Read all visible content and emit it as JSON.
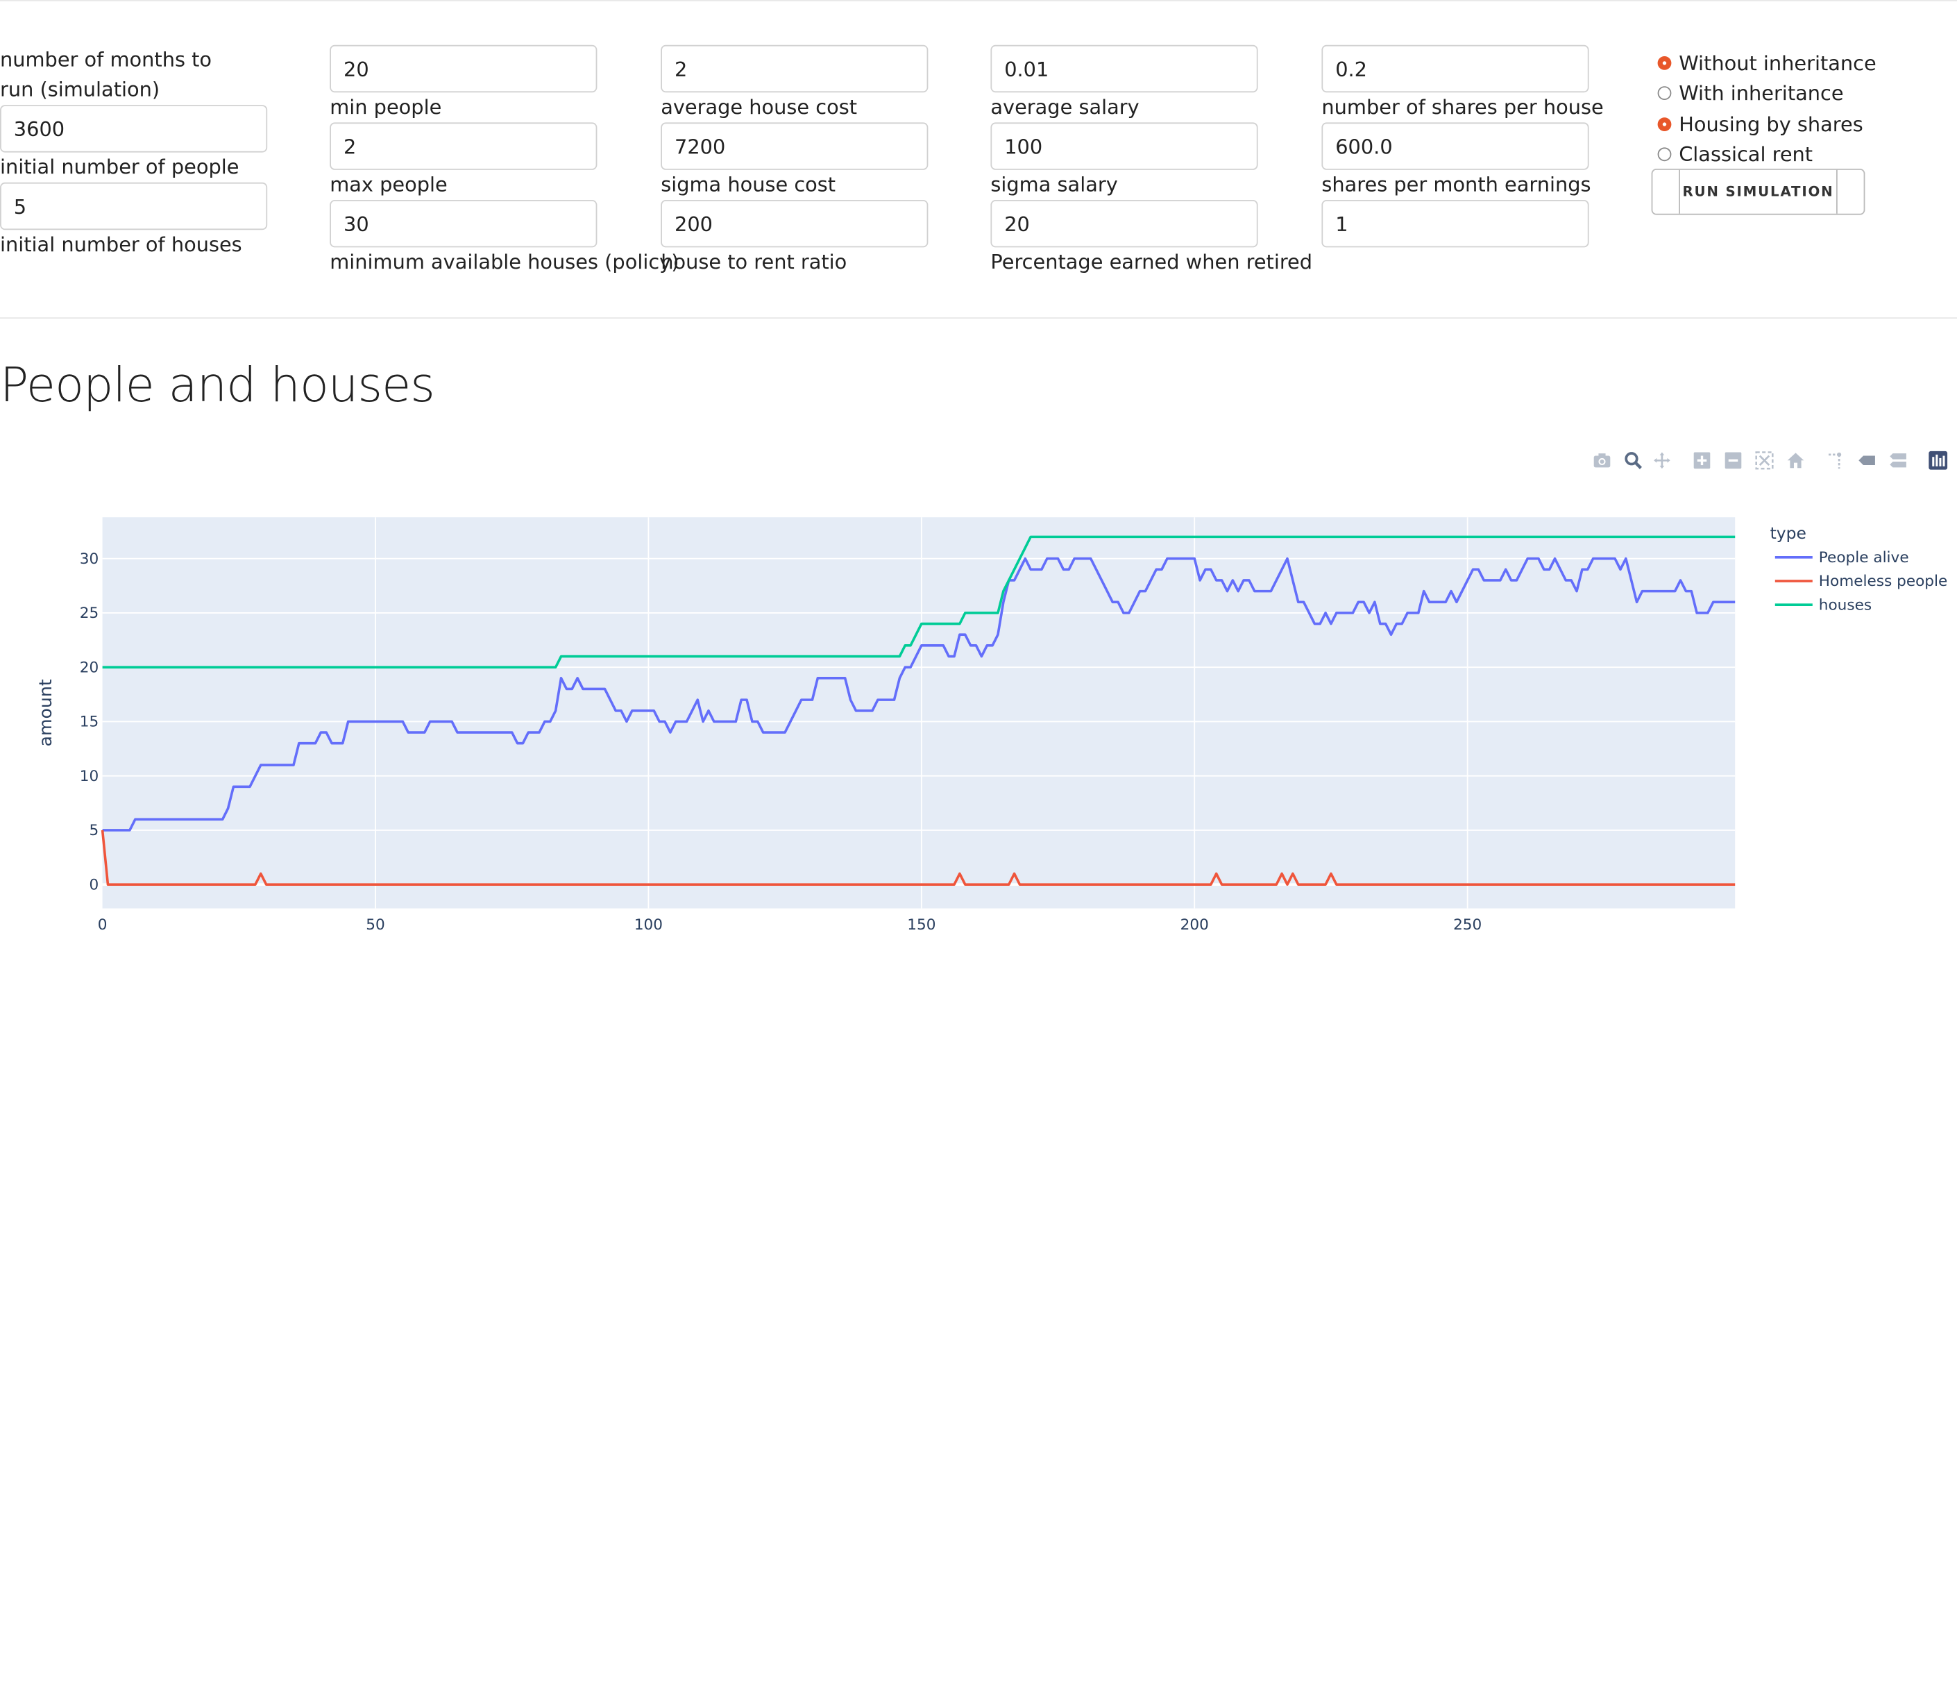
{
  "form": {
    "col1": {
      "label_months": "number of months to run (simulation)",
      "value_months": "3600",
      "label_people": "initial number of people",
      "value_people": "5",
      "label_houses": "initial number of houses"
    },
    "col2": {
      "value_initial_houses": "20",
      "label_min_people": "min people",
      "value_min_people": "2",
      "label_max_people": "max people",
      "value_max_people": "30",
      "label_min_available": "minimum available houses (policy)"
    },
    "col3": {
      "value_min_available": "2",
      "label_avg_house_cost": "average house cost",
      "value_avg_house_cost": "7200",
      "label_sigma_house_cost": "sigma house cost",
      "value_sigma_house_cost": "200",
      "label_house_rent_ratio": "house to rent ratio"
    },
    "col4": {
      "value_house_rent_ratio": "0.01",
      "label_avg_salary": "average salary",
      "value_avg_salary": "100",
      "label_sigma_salary": "sigma salary",
      "value_sigma_salary": "20",
      "label_pct_retired": "Percentage earned when retired"
    },
    "col5": {
      "value_pct_retired": "0.2",
      "label_shares_per_house": "number of shares per house",
      "value_shares_per_house": "600.0",
      "label_shares_earnings": "shares per month earnings",
      "value_shares_earnings": "1"
    },
    "radios": {
      "without_inheritance": "Without inheritance",
      "with_inheritance": "With inheritance",
      "housing_by_shares": "Housing by shares",
      "classical_rent": "Classical rent",
      "selected": [
        "Without inheritance",
        "Housing by shares"
      ]
    },
    "run_button": "RUN SIMULATION"
  },
  "section_title": "People and houses",
  "modebar_icons": [
    "camera-icon",
    "zoom-icon",
    "pan-icon",
    "zoom-in-icon",
    "zoom-out-icon",
    "autoscale-icon",
    "reset-axes-icon",
    "spike-lines-icon",
    "hover-closest-icon",
    "hover-compare-icon",
    "plotly-logo-icon"
  ],
  "colors": {
    "accent_radio": "#e8572a",
    "plot_bg": "#e5ecf6",
    "people": "#636efa",
    "homeless": "#ef553b",
    "houses": "#00cc96"
  },
  "chart_data": {
    "type": "line",
    "xlabel": "",
    "ylabel": "amount",
    "legend_title": "type",
    "legend_position": "right",
    "grid": true,
    "xlim": [
      0,
      299
    ],
    "ylim": [
      -2.2,
      33.8
    ],
    "xticks": [
      0,
      50,
      100,
      150,
      200,
      250
    ],
    "yticks": [
      0,
      5,
      10,
      15,
      20,
      25,
      30
    ],
    "series": [
      {
        "name": "People alive",
        "color": "#636efa",
        "points": [
          [
            0,
            5
          ],
          [
            5,
            5
          ],
          [
            6,
            6
          ],
          [
            22,
            6
          ],
          [
            23,
            7
          ],
          [
            24,
            9
          ],
          [
            27,
            9
          ],
          [
            29,
            11
          ],
          [
            35,
            11
          ],
          [
            36,
            13
          ],
          [
            39,
            13
          ],
          [
            40,
            14
          ],
          [
            41,
            14
          ],
          [
            42,
            13
          ],
          [
            44,
            13
          ],
          [
            45,
            15
          ],
          [
            55,
            15
          ],
          [
            56,
            14
          ],
          [
            59,
            14
          ],
          [
            60,
            15
          ],
          [
            64,
            15
          ],
          [
            65,
            14
          ],
          [
            75,
            14
          ],
          [
            76,
            13
          ],
          [
            77,
            13
          ],
          [
            78,
            14
          ],
          [
            80,
            14
          ],
          [
            81,
            15
          ],
          [
            82,
            15
          ],
          [
            83,
            16
          ],
          [
            84,
            19
          ],
          [
            85,
            18
          ],
          [
            86,
            18
          ],
          [
            87,
            19
          ],
          [
            88,
            18
          ],
          [
            92,
            18
          ],
          [
            94,
            16
          ],
          [
            95,
            16
          ],
          [
            96,
            15
          ],
          [
            97,
            16
          ],
          [
            101,
            16
          ],
          [
            102,
            15
          ],
          [
            103,
            15
          ],
          [
            104,
            14
          ],
          [
            105,
            15
          ],
          [
            107,
            15
          ],
          [
            108,
            16
          ],
          [
            109,
            17
          ],
          [
            110,
            15
          ],
          [
            111,
            16
          ],
          [
            112,
            15
          ],
          [
            116,
            15
          ],
          [
            117,
            17
          ],
          [
            118,
            17
          ],
          [
            119,
            15
          ],
          [
            120,
            15
          ],
          [
            121,
            14
          ],
          [
            125,
            14
          ],
          [
            127,
            16
          ],
          [
            128,
            17
          ],
          [
            130,
            17
          ],
          [
            131,
            19
          ],
          [
            136,
            19
          ],
          [
            137,
            17
          ],
          [
            138,
            16
          ],
          [
            141,
            16
          ],
          [
            142,
            17
          ],
          [
            145,
            17
          ],
          [
            146,
            19
          ],
          [
            147,
            20
          ],
          [
            148,
            20
          ],
          [
            149,
            21
          ],
          [
            150,
            22
          ],
          [
            154,
            22
          ],
          [
            155,
            21
          ],
          [
            156,
            21
          ],
          [
            157,
            23
          ],
          [
            158,
            23
          ],
          [
            159,
            22
          ],
          [
            160,
            22
          ],
          [
            161,
            21
          ],
          [
            162,
            22
          ],
          [
            163,
            22
          ],
          [
            164,
            23
          ],
          [
            165,
            26
          ],
          [
            166,
            28
          ],
          [
            167,
            28
          ],
          [
            168,
            29
          ],
          [
            169,
            30
          ],
          [
            170,
            29
          ],
          [
            172,
            29
          ],
          [
            173,
            30
          ],
          [
            175,
            30
          ],
          [
            176,
            29
          ],
          [
            177,
            29
          ],
          [
            178,
            30
          ],
          [
            181,
            30
          ],
          [
            182,
            29
          ],
          [
            184,
            27
          ],
          [
            185,
            26
          ],
          [
            186,
            26
          ],
          [
            187,
            25
          ],
          [
            188,
            25
          ],
          [
            189,
            26
          ],
          [
            190,
            27
          ],
          [
            191,
            27
          ],
          [
            192,
            28
          ],
          [
            193,
            29
          ],
          [
            194,
            29
          ],
          [
            195,
            30
          ],
          [
            200,
            30
          ],
          [
            201,
            28
          ],
          [
            202,
            29
          ],
          [
            203,
            29
          ],
          [
            204,
            28
          ],
          [
            205,
            28
          ],
          [
            206,
            27
          ],
          [
            207,
            28
          ],
          [
            208,
            27
          ],
          [
            209,
            28
          ],
          [
            210,
            28
          ],
          [
            211,
            27
          ],
          [
            214,
            27
          ],
          [
            215,
            28
          ],
          [
            217,
            30
          ],
          [
            219,
            26
          ],
          [
            220,
            26
          ],
          [
            221,
            25
          ],
          [
            222,
            24
          ],
          [
            223,
            24
          ],
          [
            224,
            25
          ],
          [
            225,
            24
          ],
          [
            226,
            25
          ],
          [
            229,
            25
          ],
          [
            230,
            26
          ],
          [
            231,
            26
          ],
          [
            232,
            25
          ],
          [
            233,
            26
          ],
          [
            234,
            24
          ],
          [
            235,
            24
          ],
          [
            236,
            23
          ],
          [
            237,
            24
          ],
          [
            238,
            24
          ],
          [
            239,
            25
          ],
          [
            241,
            25
          ],
          [
            242,
            27
          ],
          [
            243,
            26
          ],
          [
            246,
            26
          ],
          [
            247,
            27
          ],
          [
            248,
            26
          ],
          [
            249,
            27
          ],
          [
            250,
            28
          ],
          [
            251,
            29
          ],
          [
            252,
            29
          ],
          [
            253,
            28
          ],
          [
            256,
            28
          ],
          [
            257,
            29
          ],
          [
            258,
            28
          ],
          [
            259,
            28
          ],
          [
            260,
            29
          ],
          [
            261,
            30
          ],
          [
            263,
            30
          ],
          [
            264,
            29
          ],
          [
            265,
            29
          ],
          [
            266,
            30
          ],
          [
            267,
            29
          ],
          [
            268,
            28
          ],
          [
            269,
            28
          ],
          [
            270,
            27
          ],
          [
            271,
            29
          ],
          [
            272,
            29
          ],
          [
            273,
            30
          ],
          [
            277,
            30
          ],
          [
            278,
            29
          ],
          [
            279,
            30
          ],
          [
            280,
            28
          ],
          [
            281,
            26
          ],
          [
            282,
            27
          ],
          [
            288,
            27
          ],
          [
            289,
            28
          ],
          [
            290,
            27
          ],
          [
            291,
            27
          ],
          [
            292,
            25
          ],
          [
            294,
            25
          ],
          [
            295,
            26
          ],
          [
            299,
            26
          ]
        ]
      },
      {
        "name": "Homeless people",
        "color": "#ef553b",
        "points": [
          [
            0,
            5
          ],
          [
            1,
            0
          ],
          [
            28,
            0
          ],
          [
            29,
            1
          ],
          [
            30,
            0
          ],
          [
            156,
            0
          ],
          [
            157,
            1
          ],
          [
            158,
            0
          ],
          [
            166,
            0
          ],
          [
            167,
            1
          ],
          [
            168,
            0
          ],
          [
            203,
            0
          ],
          [
            204,
            1
          ],
          [
            205,
            0
          ],
          [
            215,
            0
          ],
          [
            216,
            1
          ],
          [
            217,
            0
          ],
          [
            218,
            1
          ],
          [
            219,
            0
          ],
          [
            224,
            0
          ],
          [
            225,
            1
          ],
          [
            226,
            0
          ],
          [
            299,
            0
          ]
        ]
      },
      {
        "name": "houses",
        "color": "#00cc96",
        "points": [
          [
            0,
            20
          ],
          [
            83,
            20
          ],
          [
            84,
            21
          ],
          [
            146,
            21
          ],
          [
            147,
            22
          ],
          [
            148,
            22
          ],
          [
            149,
            23
          ],
          [
            150,
            24
          ],
          [
            157,
            24
          ],
          [
            158,
            25
          ],
          [
            164,
            25
          ],
          [
            165,
            27
          ],
          [
            166,
            28
          ],
          [
            170,
            32
          ],
          [
            299,
            32
          ]
        ]
      }
    ]
  }
}
